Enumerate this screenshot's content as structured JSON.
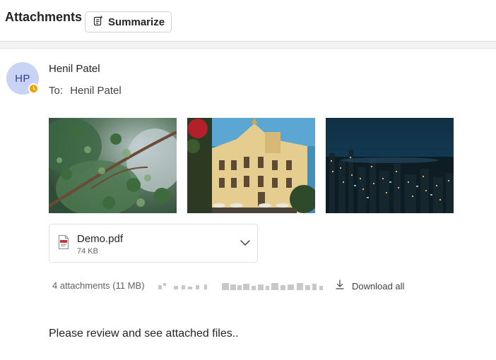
{
  "header": {
    "title": "Attachments",
    "summarize_label": "Summarize"
  },
  "message": {
    "avatar_initials": "HP",
    "sender": "Henil Patel",
    "to_label": "To:",
    "to_name": "Henil Patel",
    "body": "Please review and see attached files.."
  },
  "images": [
    {
      "icon": "image-evergreen-branches"
    },
    {
      "icon": "image-ornate-building"
    },
    {
      "icon": "image-city-night-skyline"
    }
  ],
  "file": {
    "name": "Demo.pdf",
    "size": "74 KB",
    "icon": "pdf-file-icon"
  },
  "attachments_bar": {
    "summary": "4 attachments (11 MB)",
    "download_label": "Download all"
  },
  "colors": {
    "avatar_bg": "#c9d3f6",
    "avatar_text": "#2e3f8f",
    "presence": "#eaa300"
  }
}
